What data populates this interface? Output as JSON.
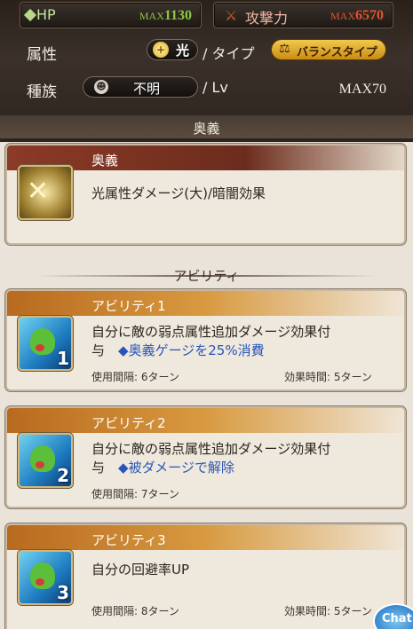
{
  "stats": {
    "hp_label": "HP",
    "hp_max_prefix": "MAX",
    "hp_value": "1130",
    "atk_label": "攻撃力",
    "atk_max_prefix": "MAX",
    "atk_value": "6570"
  },
  "profile": {
    "attribute_label": "属性",
    "attribute_value": "光",
    "type_label": "/ タイプ",
    "type_value": "バランスタイプ",
    "race_label": "種族",
    "race_value": "不明",
    "lv_label": "/ Lv",
    "max_lv": "MAX70"
  },
  "ougi_section": {
    "header": "奥義",
    "card_title": "奥義",
    "description": "光属性ダメージ(大)/暗闇効果"
  },
  "ability_section": {
    "header": "アビリティ",
    "abilities": [
      {
        "title": "アビリティ1",
        "line1": "自分に敵の弱点属性追加ダメージ効果付",
        "line2_prefix": "与",
        "line2_note": "◆奥義ゲージを25%消費",
        "cooldown": "使用間隔: 6ターン",
        "duration": "効果時間: 5ターン",
        "badge": "1"
      },
      {
        "title": "アビリティ2",
        "line1": "自分に敵の弱点属性追加ダメージ効果付",
        "line2_prefix": "与",
        "line2_note": "◆被ダメージで解除",
        "cooldown": "使用間隔: 7ターン",
        "duration": "",
        "badge": "2"
      },
      {
        "title": "アビリティ3",
        "line1": "自分の回避率UP",
        "line2_prefix": "",
        "line2_note": "",
        "cooldown": "使用間隔: 8ターン",
        "duration": "効果時間: 5ターン",
        "badge": "3"
      }
    ]
  },
  "chat_label": "Chat",
  "colors": {
    "hp_accent": "#8cc640",
    "atk_accent": "#e0532f",
    "note_blue": "#2856b8"
  }
}
